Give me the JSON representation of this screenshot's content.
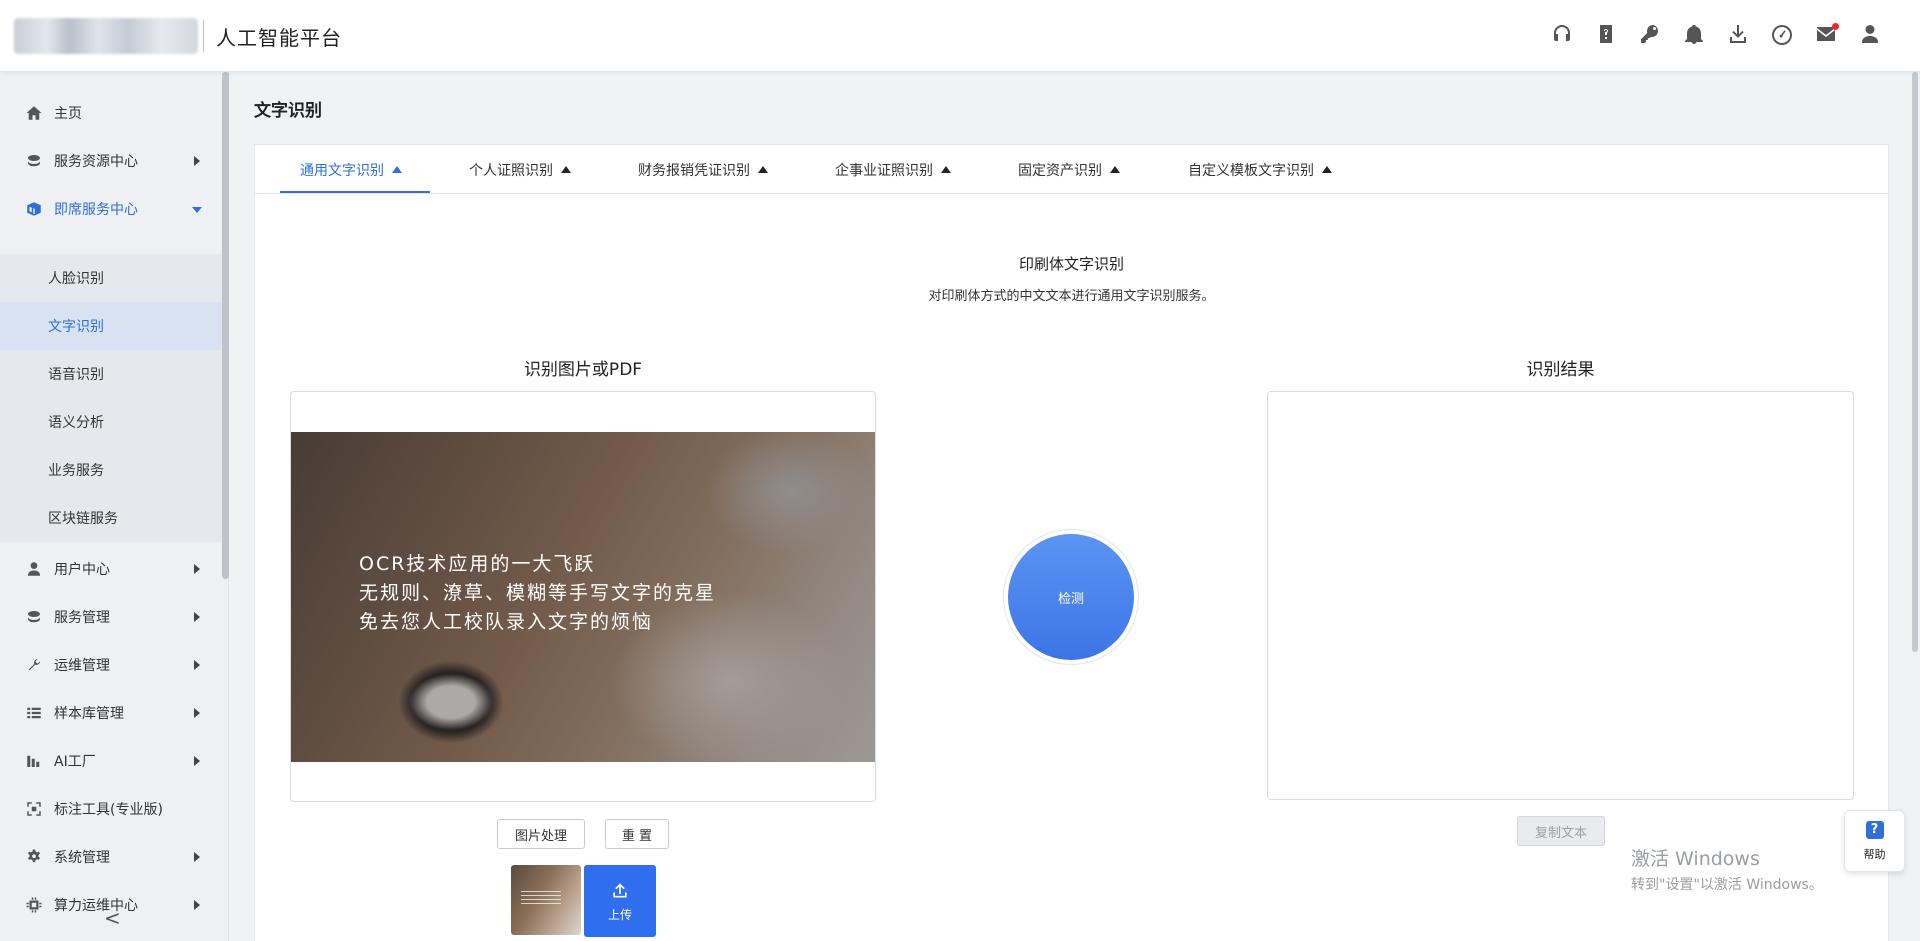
{
  "header": {
    "title": "人工智能平台",
    "icons": [
      "headset-icon",
      "manual-icon",
      "key-icon",
      "bell-icon",
      "download-icon",
      "dashboard-icon",
      "mail-icon",
      "user-icon"
    ]
  },
  "sidebar": {
    "items": [
      {
        "label": "主页",
        "icon": "home-icon"
      },
      {
        "label": "服务资源中心",
        "icon": "resource-icon"
      },
      {
        "label": "即席服务中心",
        "icon": "instant-service-icon"
      },
      {
        "label": "用户中心",
        "icon": "user-icon"
      },
      {
        "label": "服务管理",
        "icon": "service-icon"
      },
      {
        "label": "运维管理",
        "icon": "wrench-icon"
      },
      {
        "label": "样本库管理",
        "icon": "list-icon"
      },
      {
        "label": "AI工厂",
        "icon": "factory-icon"
      },
      {
        "label": "标注工具(专业版)",
        "icon": "annotate-icon"
      },
      {
        "label": "系统管理",
        "icon": "gear-icon"
      },
      {
        "label": "算力运维中心",
        "icon": "chip-icon"
      }
    ],
    "subitems": [
      {
        "label": "人脸识别"
      },
      {
        "label": "文字识别"
      },
      {
        "label": "语音识别"
      },
      {
        "label": "语义分析"
      },
      {
        "label": "业务服务"
      },
      {
        "label": "区块链服务"
      }
    ],
    "collapse_label": "<"
  },
  "page": {
    "title": "文字识别",
    "tabs": [
      {
        "label": "通用文字识别"
      },
      {
        "label": "个人证照识别"
      },
      {
        "label": "财务报销凭证识别"
      },
      {
        "label": "企事业证照识别"
      },
      {
        "label": "固定资产识别"
      },
      {
        "label": "自定义模板文字识别"
      }
    ],
    "section_title": "印刷体文字识别",
    "section_desc": "对印刷体方式的中文文本进行通用文字识别服务。",
    "left_panel_title": "识别图片或PDF",
    "right_panel_title": "识别结果",
    "preview_lines": [
      "OCR技术应用的一大飞跃",
      "无规则、潦草、模糊等手写文字的克星",
      "免去您人工校队录入文字的烦恼"
    ],
    "image_process_label": "图片处理",
    "reset_label": "重 置",
    "upload_label": "上传",
    "detect_label": "检测",
    "copy_label": "复制文本"
  },
  "watermark": {
    "line1": "激活 Windows",
    "line2": "转到\"设置\"以激活 Windows。"
  },
  "help": {
    "icon_text": "?",
    "label": "帮助"
  },
  "colors": {
    "accent": "#2f6fd8",
    "upload": "#2f6fef",
    "notification": "#f5222d"
  }
}
